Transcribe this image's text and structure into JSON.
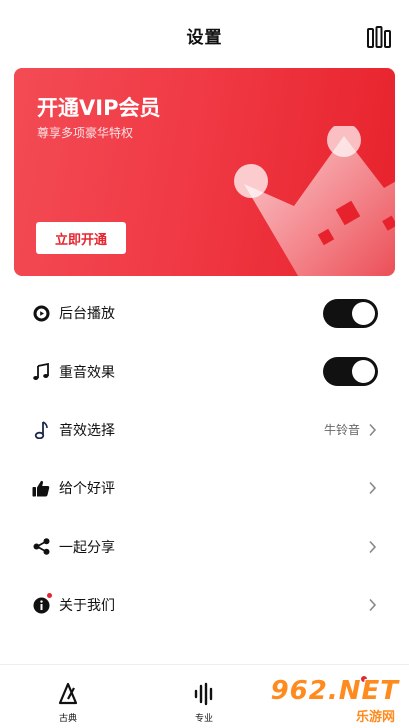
{
  "header": {
    "title": "设置",
    "menu_icon": "equalizer-icon"
  },
  "vip": {
    "title": "开通VIP会员",
    "subtitle": "尊享多项豪华特权",
    "button_label": "立即开通",
    "gradient": [
      "#f34b55",
      "#e7222c"
    ]
  },
  "settings": [
    {
      "label": "后台播放",
      "icon": "play-circle-icon",
      "type": "toggle",
      "on": true
    },
    {
      "label": "重音效果",
      "icon": "music-note-icon",
      "type": "toggle",
      "on": true
    },
    {
      "label": "音效选择",
      "icon": "note-icon",
      "type": "select",
      "value": "牛铃音"
    },
    {
      "label": "给个好评",
      "icon": "thumbs-up-icon",
      "type": "link"
    },
    {
      "label": "一起分享",
      "icon": "share-icon",
      "type": "link"
    },
    {
      "label": "关于我们",
      "icon": "info-icon",
      "type": "link",
      "badge": true
    }
  ],
  "tabs": [
    {
      "label": "古典",
      "icon": "metronome-icon"
    },
    {
      "label": "专业",
      "icon": "waveform-icon"
    }
  ],
  "watermark": {
    "brand": "962.NET",
    "sub": "乐游网"
  },
  "colors": {
    "accent": "#e52530",
    "toggle_on": "#111111"
  }
}
